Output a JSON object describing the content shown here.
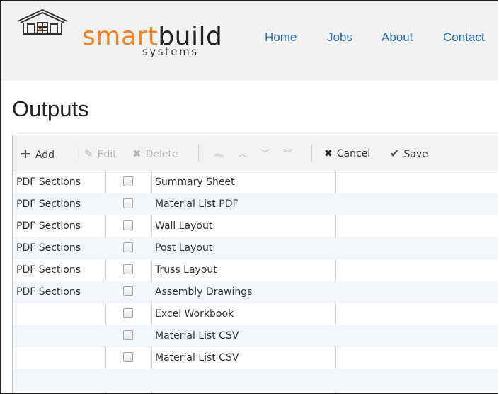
{
  "brand": {
    "smart": "smart",
    "build": "build",
    "sub": "systems",
    "accent": "#f58220",
    "logo_icon": "house-logo-icon"
  },
  "nav": {
    "home": "Home",
    "jobs": "Jobs",
    "about": "About",
    "contact": "Contact"
  },
  "page": {
    "title": "Outputs"
  },
  "toolbar": {
    "add": "Add",
    "edit": "Edit",
    "delete": "Delete",
    "cancel": "Cancel",
    "save": "Save"
  },
  "rows": [
    {
      "group": "PDF Sections",
      "checked": false,
      "name": "Summary Sheet"
    },
    {
      "group": "PDF Sections",
      "checked": false,
      "name": "Material List PDF"
    },
    {
      "group": "PDF Sections",
      "checked": false,
      "name": "Wall Layout"
    },
    {
      "group": "PDF Sections",
      "checked": false,
      "name": "Post Layout"
    },
    {
      "group": "PDF Sections",
      "checked": false,
      "name": "Truss Layout"
    },
    {
      "group": "PDF Sections",
      "checked": false,
      "name": "Assembly Drawings"
    },
    {
      "group": "",
      "checked": false,
      "name": "Excel Workbook"
    },
    {
      "group": "",
      "checked": false,
      "name": "Material List CSV"
    },
    {
      "group": "",
      "checked": false,
      "name": "Material List CSV"
    },
    {
      "group": "",
      "checked": null,
      "name": ""
    }
  ]
}
